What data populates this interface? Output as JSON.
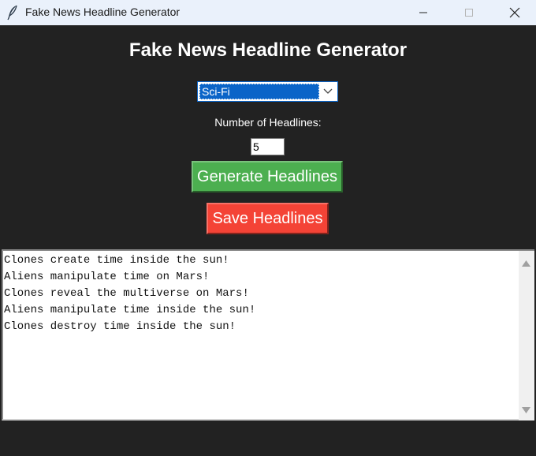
{
  "window": {
    "title": "Fake News Headline Generator",
    "controls": [
      "minimize",
      "maximize",
      "close"
    ]
  },
  "app": {
    "heading": "Fake News Headline Generator",
    "category": {
      "selected": "Sci-Fi"
    },
    "count": {
      "label": "Number of Headlines:",
      "value": "5"
    },
    "buttons": {
      "generate": "Generate Headlines",
      "save": "Save Headlines"
    },
    "output": {
      "lines": [
        "Clones create time inside the sun!",
        "Aliens manipulate time on Mars!",
        "Clones reveal the multiverse on Mars!",
        "Aliens manipulate time inside the sun!",
        "Clones destroy time inside the sun!"
      ]
    }
  },
  "colors": {
    "background": "#222222",
    "generate_button": "#4caf50",
    "save_button": "#f44336",
    "selection": "#0a64c8"
  }
}
